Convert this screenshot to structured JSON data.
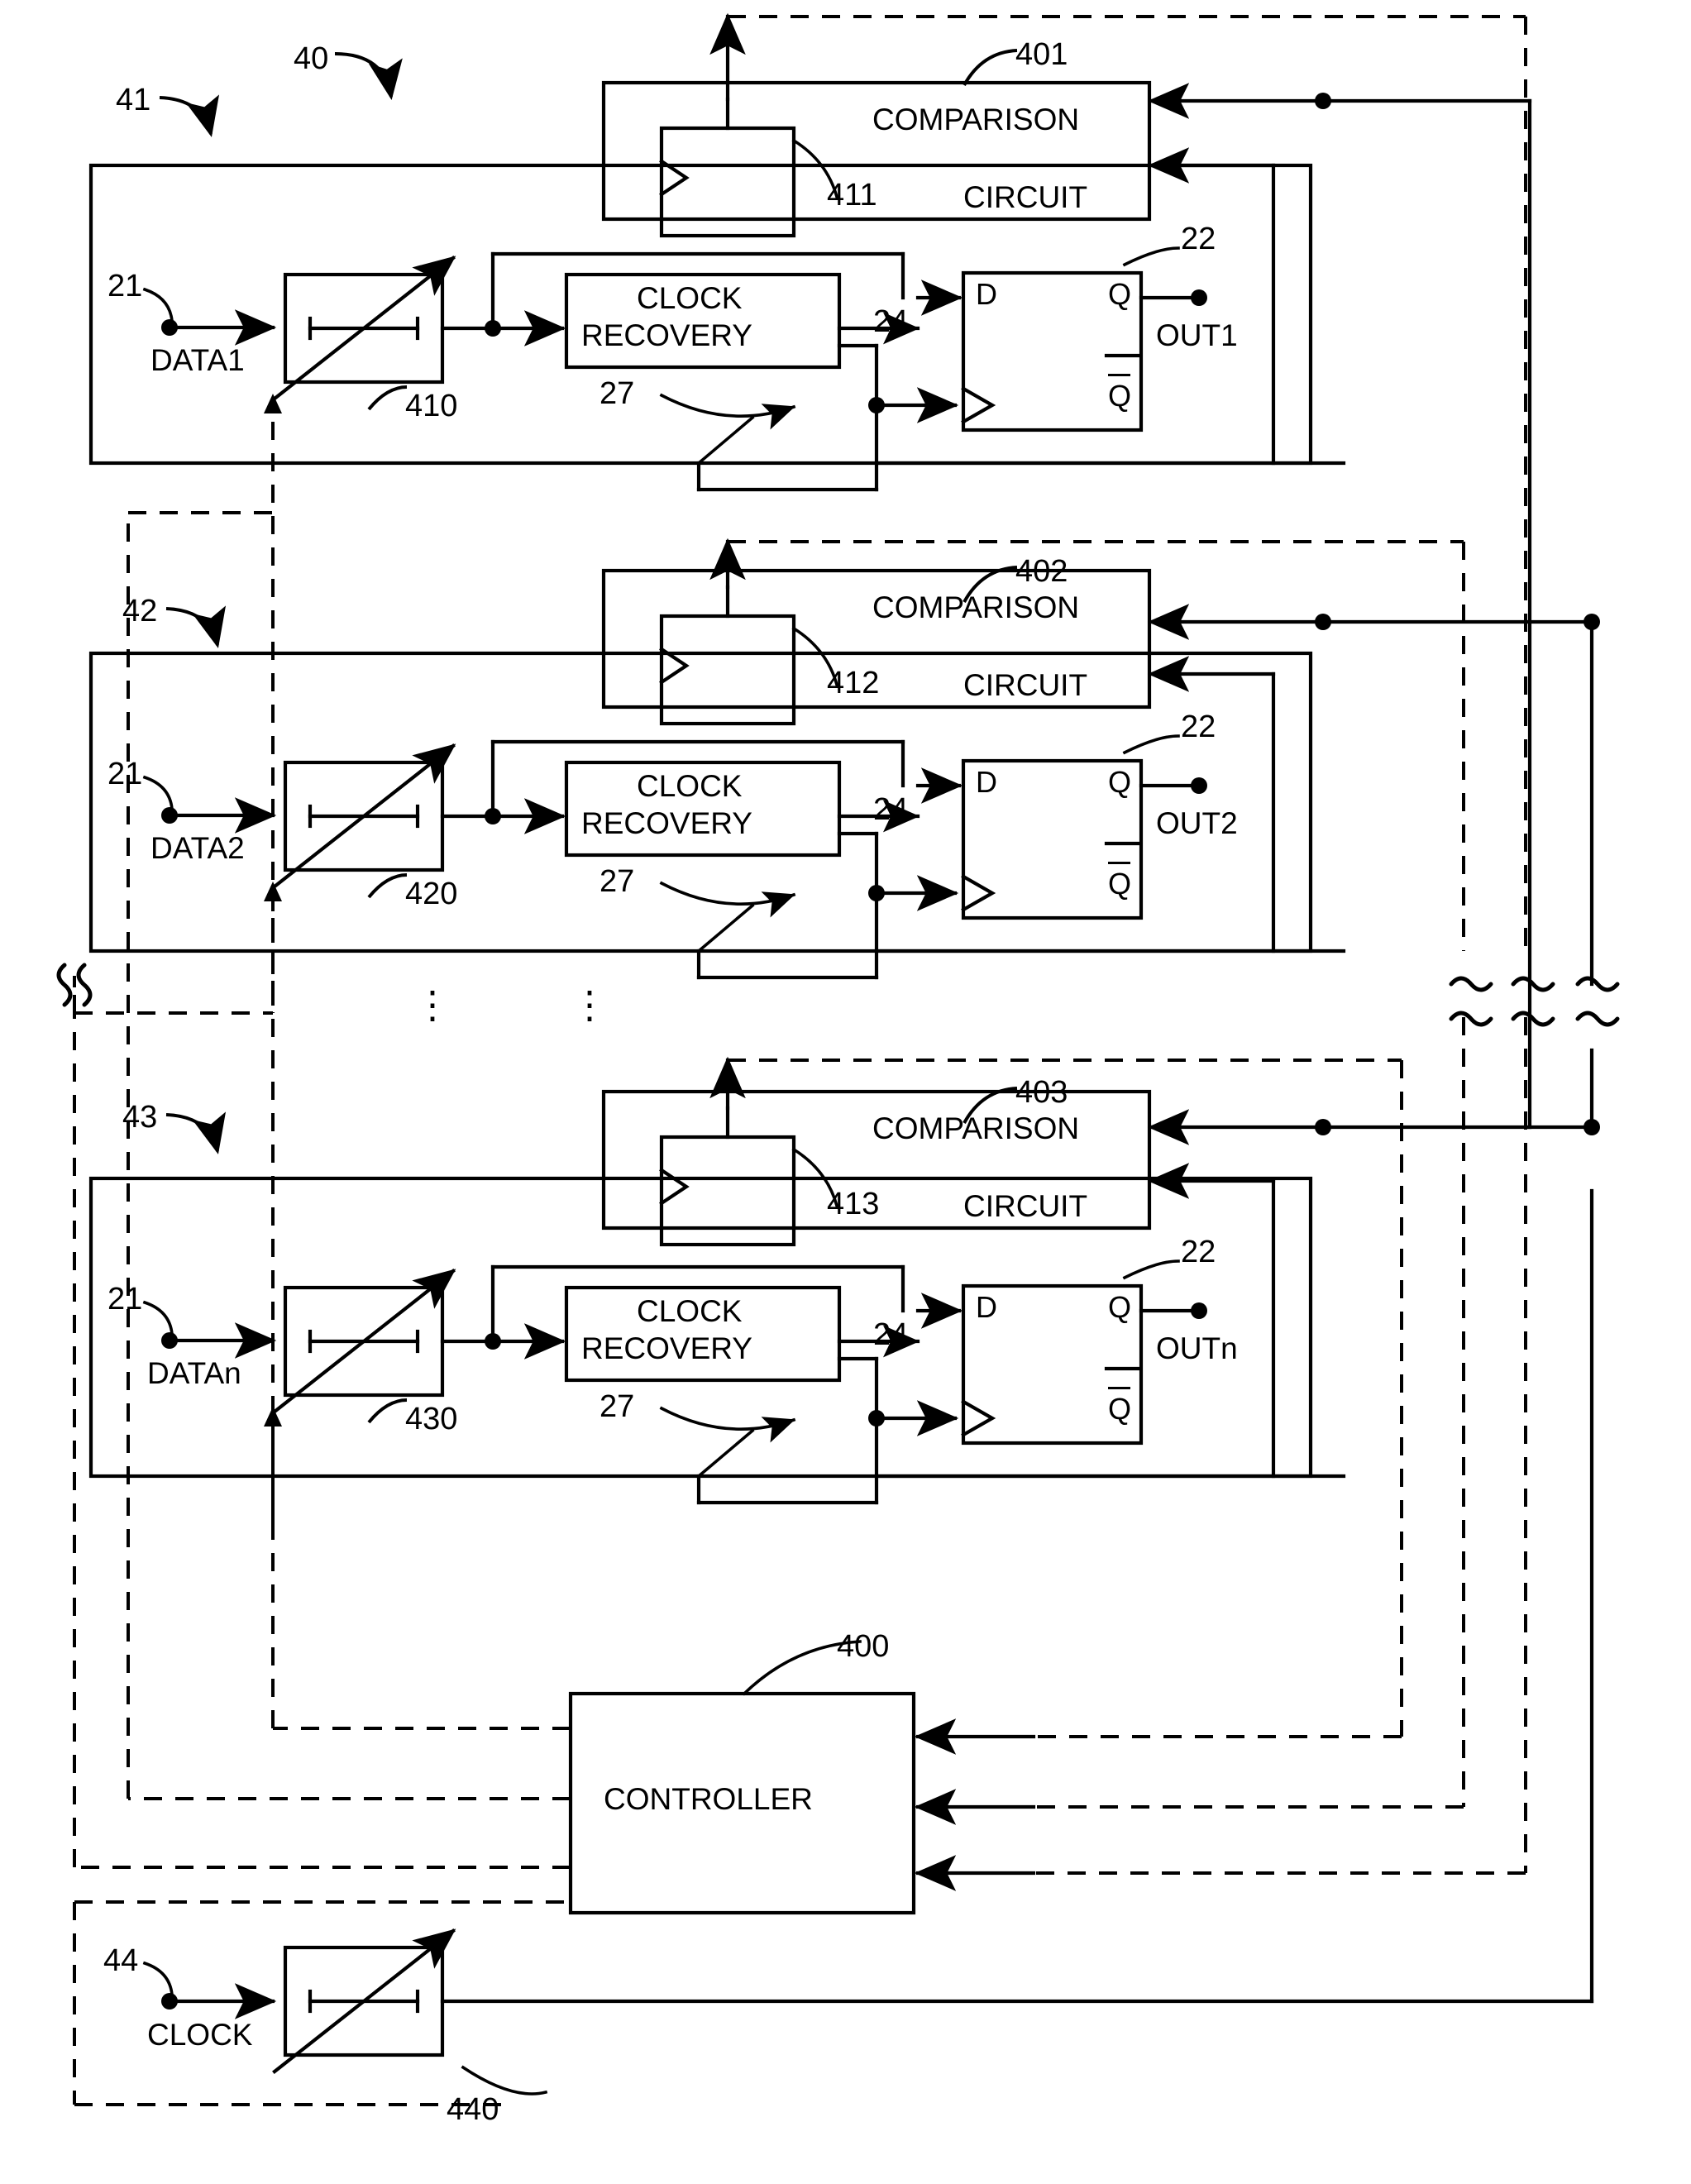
{
  "figure": {
    "type": "patent-block-diagram",
    "overall_ref": "40",
    "channels": [
      {
        "channel_ref": "41",
        "input_ref": "21",
        "input_label": "DATA1",
        "attenuator_ref": "410",
        "comparison_circuit_ref": "401",
        "comparison_title_line1": "COMPARISON",
        "comparison_title_line2": "CIRCUIT",
        "comparison_flipflop_ref": "411",
        "clock_recovery_line1": "CLOCK",
        "clock_recovery_line2": "RECOVERY",
        "clock_recovery_ref": "27",
        "recovered_clock_ref": "24",
        "dff_ref": "22",
        "dff_d_label": "D",
        "dff_q_label": "Q",
        "dff_qbar_label": "Q",
        "output_label": "OUT1"
      },
      {
        "channel_ref": "42",
        "input_ref": "21",
        "input_label": "DATA2",
        "attenuator_ref": "420",
        "comparison_circuit_ref": "402",
        "comparison_title_line1": "COMPARISON",
        "comparison_title_line2": "CIRCUIT",
        "comparison_flipflop_ref": "412",
        "clock_recovery_line1": "CLOCK",
        "clock_recovery_line2": "RECOVERY",
        "clock_recovery_ref": "27",
        "recovered_clock_ref": "24",
        "dff_ref": "22",
        "dff_d_label": "D",
        "dff_q_label": "Q",
        "dff_qbar_label": "Q",
        "output_label": "OUT2"
      },
      {
        "channel_ref": "43",
        "input_ref": "21",
        "input_label": "DATAn",
        "attenuator_ref": "430",
        "comparison_circuit_ref": "403",
        "comparison_title_line1": "COMPARISON",
        "comparison_title_line2": "CIRCUIT",
        "comparison_flipflop_ref": "413",
        "clock_recovery_line1": "CLOCK",
        "clock_recovery_line2": "RECOVERY",
        "clock_recovery_ref": "27",
        "recovered_clock_ref": "24",
        "dff_ref": "22",
        "dff_d_label": "D",
        "dff_q_label": "Q",
        "dff_qbar_label": "Q",
        "output_label": "OUTn"
      }
    ],
    "controller": {
      "label": "CONTROLLER",
      "ref": "400"
    },
    "clock_path": {
      "input_ref": "44",
      "input_label": "CLOCK",
      "attenuator_ref": "440"
    },
    "ellipsis": "⋮",
    "colors": {
      "line": "#000000",
      "background": "#ffffff"
    }
  }
}
